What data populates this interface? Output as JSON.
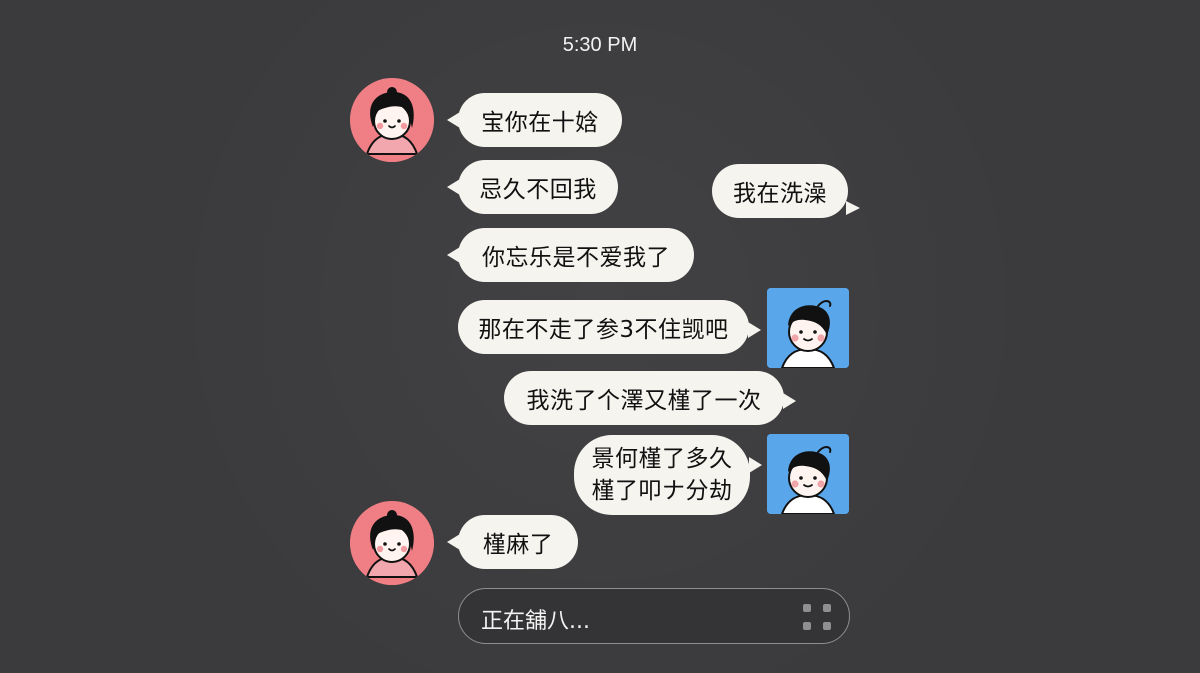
{
  "status_bar": {
    "time": "5:30 PM"
  },
  "messages": [
    {
      "id": 1,
      "side": "left",
      "text": "宝你在十娢"
    },
    {
      "id": 2,
      "side": "left",
      "text": "忌久不回我"
    },
    {
      "id": 3,
      "side": "right",
      "text": "我在洗澡"
    },
    {
      "id": 4,
      "side": "left",
      "text": "你忘乐是不爱我了"
    },
    {
      "id": 5,
      "side": "right",
      "text": "那在不走了参3不住觊吧"
    },
    {
      "id": 6,
      "side": "right",
      "text": "我洗了个澤又槿了一次"
    },
    {
      "id": 7,
      "side": "right",
      "lines": [
        "景何槿了多久",
        "槿了叩ナ分劫"
      ]
    },
    {
      "id": 8,
      "side": "left",
      "text": "槿麻了"
    }
  ],
  "composer": {
    "text": "正在舖八...",
    "icon": "scan-icon"
  },
  "avatars": {
    "girl": {
      "icon": "girl-avatar-icon",
      "color": "#ef7f85"
    },
    "boy": {
      "icon": "boy-avatar-icon",
      "color": "#5aa6ea"
    }
  },
  "colors": {
    "background": "#3b3b3d",
    "bubble": "#f5f4ef",
    "composer_border": "#8e8e90"
  }
}
